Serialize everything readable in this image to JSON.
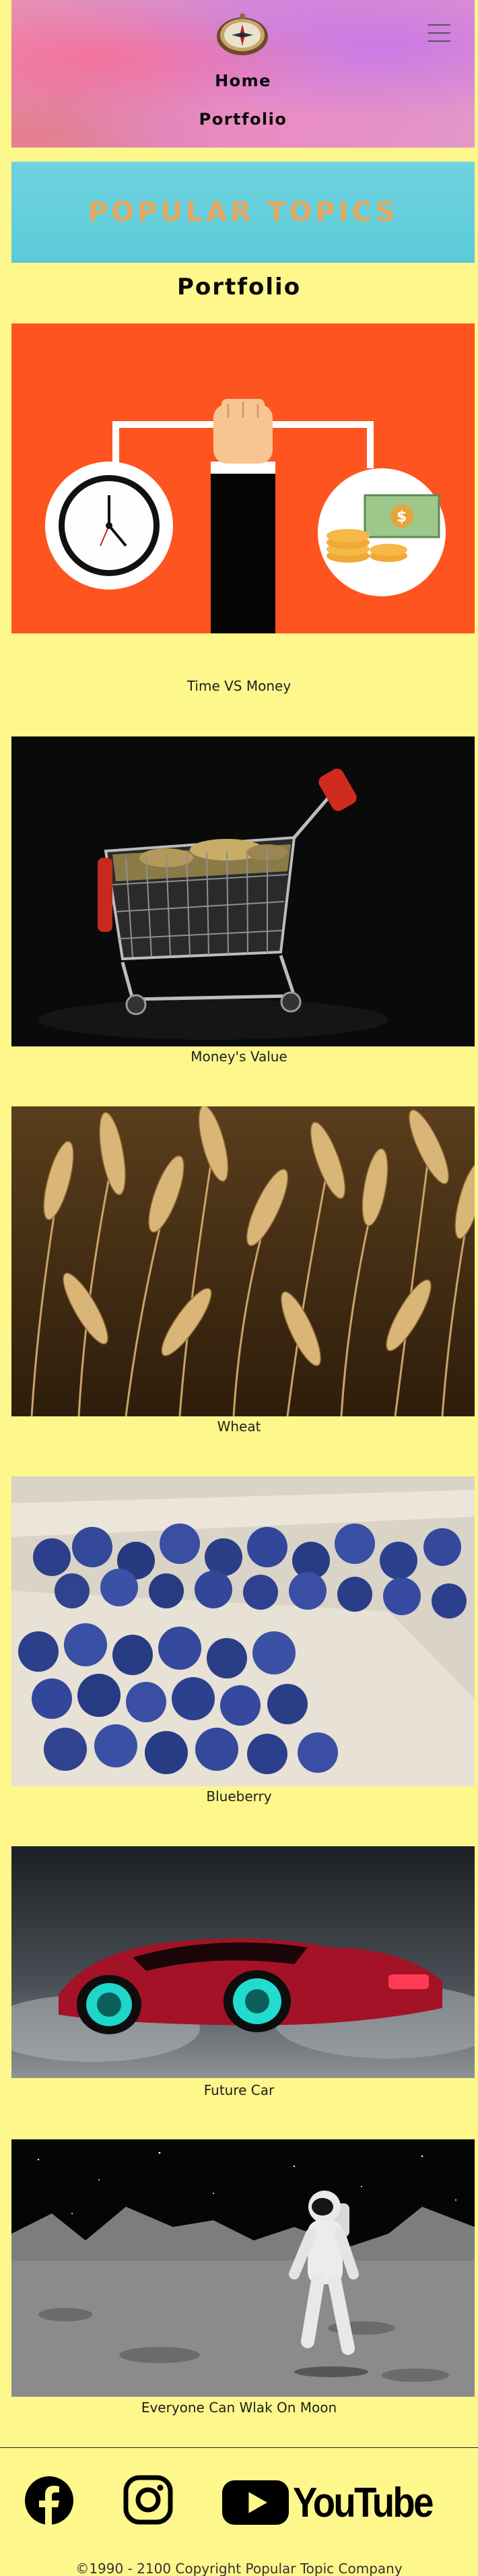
{
  "header": {
    "nav": [
      {
        "label": "Home"
      },
      {
        "label": "Portfolio"
      }
    ]
  },
  "banner": {
    "title": "POPULAR TOPICS"
  },
  "page_title": "Portfolio",
  "portfolio": [
    {
      "caption": "Time VS Money",
      "image": "time-vs-money-illustration"
    },
    {
      "caption": "Money's Value",
      "image": "shopping-cart-with-coins-photo"
    },
    {
      "caption": "Wheat",
      "image": "wheat-field-photo"
    },
    {
      "caption": "Blueberry",
      "image": "blueberries-photo"
    },
    {
      "caption": "Future Car",
      "image": "futuristic-red-car-photo"
    },
    {
      "caption": "Everyone Can Wlak On Moon",
      "image": "astronaut-on-moon-photo"
    }
  ],
  "footer": {
    "social": [
      {
        "name": "facebook-icon"
      },
      {
        "name": "instagram-icon"
      },
      {
        "name": "youtube-logo",
        "label": "YouTube"
      }
    ],
    "copyright": "©1990 - 2100 Copyright Popular Topic Company"
  },
  "colors": {
    "page_bg": "#fdf78c",
    "banner_bg": "#5ccad8",
    "banner_text": "#e4a85f",
    "card1_bg": "#fe5420"
  }
}
